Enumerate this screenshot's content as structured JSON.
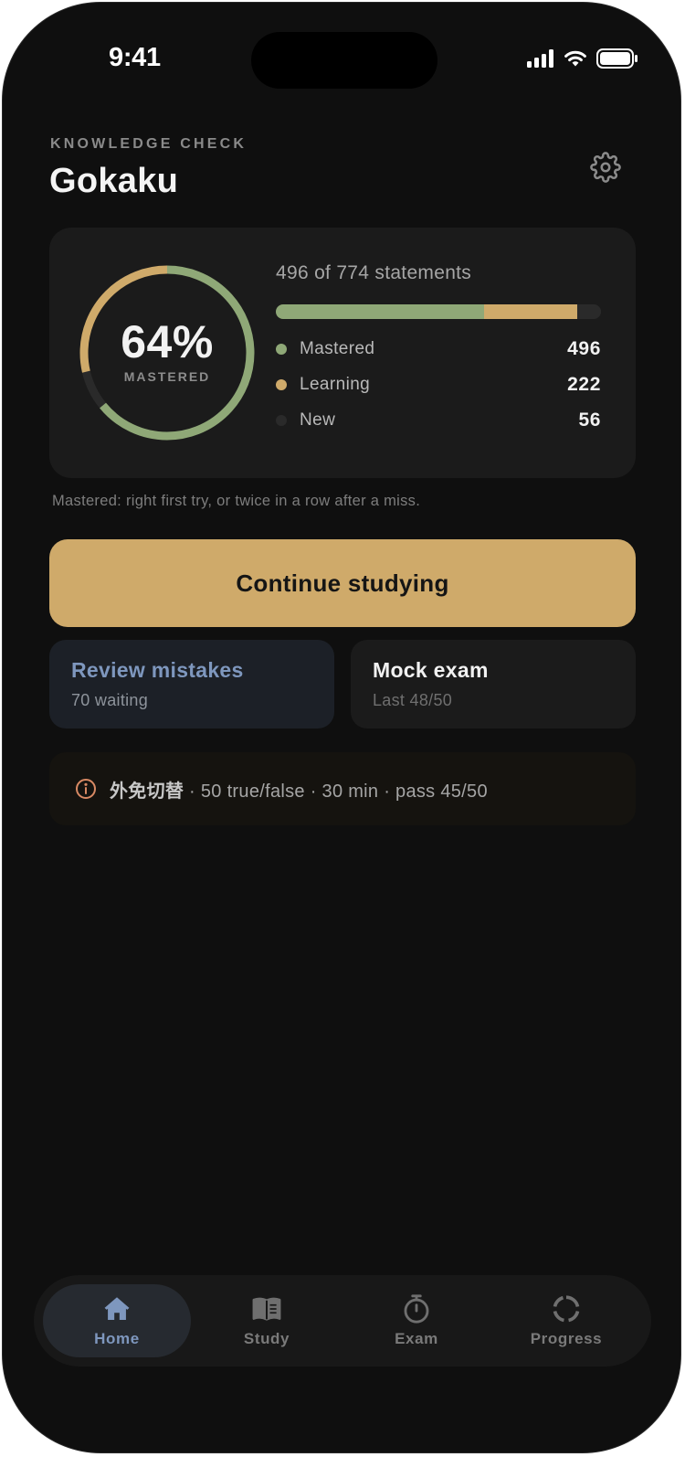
{
  "status_bar": {
    "time": "9:41",
    "icons": [
      "cellular-signal-icon",
      "wifi-icon",
      "battery-icon"
    ]
  },
  "header": {
    "eyebrow": "KNOWLEDGE CHECK",
    "title": "Gokaku",
    "settings_icon": "gear-icon"
  },
  "summary": {
    "percent": "64%",
    "percent_label": "MASTERED",
    "statements_text": "496 of 774 statements",
    "total": 774,
    "legend": [
      {
        "label": "Mastered",
        "value": "496",
        "count": 496,
        "color": "#8fa877"
      },
      {
        "label": "Learning",
        "value": "222",
        "count": 222,
        "color": "#cfaa6a"
      },
      {
        "label": "New",
        "value": "56",
        "count": 56,
        "color": "#2a2a2a"
      }
    ],
    "caption": "Mastered: right first try, or twice in a row after a miss."
  },
  "actions": {
    "primary_label": "Continue studying",
    "review": {
      "title": "Review mistakes",
      "subtitle": "70 waiting"
    },
    "mock": {
      "title": "Mock exam",
      "subtitle": "Last 48/50"
    }
  },
  "info_banner": {
    "icon": "info-icon",
    "japanese": "外免切替",
    "details": " · 50 true/false · 30 min · pass 45/50"
  },
  "tab_bar": {
    "tabs": [
      {
        "label": "Home",
        "icon": "home-icon",
        "active": true
      },
      {
        "label": "Study",
        "icon": "book-icon",
        "active": false
      },
      {
        "label": "Exam",
        "icon": "stopwatch-icon",
        "active": false
      },
      {
        "label": "Progress",
        "icon": "progress-ring-icon",
        "active": false
      }
    ]
  },
  "colors": {
    "background": "#0f0f0f",
    "card": "#1b1b1b",
    "accent_gold": "#cfaa6a",
    "mastered_green": "#8fa877",
    "active_blue": "#7e97be"
  }
}
